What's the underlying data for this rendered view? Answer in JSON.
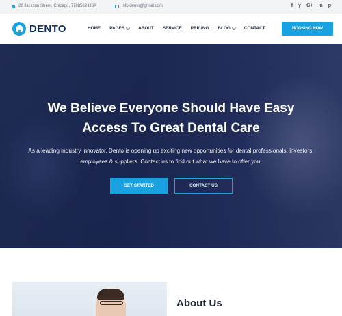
{
  "topbar": {
    "address": "28 Jackson Street, Chicago, 7788569 USA",
    "email": "info.dento@gmail.com",
    "social": [
      "f",
      "y",
      "G+",
      "in",
      "p"
    ]
  },
  "nav": {
    "brand": "DENTO",
    "items": [
      {
        "label": "HOME"
      },
      {
        "label": "PAGES",
        "dropdown": true
      },
      {
        "label": "ABOUT"
      },
      {
        "label": "SERVICE"
      },
      {
        "label": "PRICING"
      },
      {
        "label": "BLOG",
        "dropdown": true
      },
      {
        "label": "CONTACT"
      }
    ],
    "cta": "BOOKING NOW"
  },
  "hero": {
    "title_line1": "We Believe Everyone Should Have Easy",
    "title_line2": "Access To Great Dental Care",
    "text": "As a leading industry innovator, Dento is opening up exciting new opportunities for dental professionals, investors, employees & suppliers. Contact us to find out what we have to offer you.",
    "primary_button": "GET STARTED",
    "secondary_button": "CONTACT US"
  },
  "about": {
    "title": "About Us"
  },
  "colors": {
    "accent": "#1aa2e0",
    "brand_text": "#0f2c5c",
    "hero_overlay": "#1e2a55"
  }
}
